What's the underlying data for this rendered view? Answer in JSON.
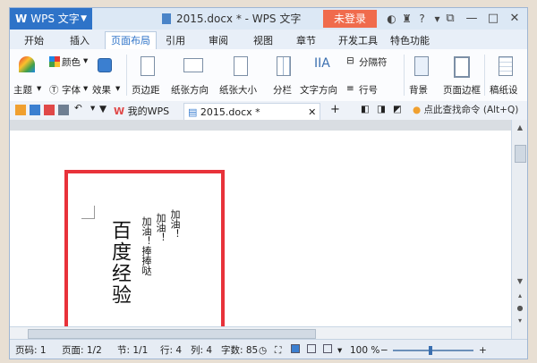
{
  "app": {
    "name": "WPS 文字",
    "logo": "W"
  },
  "document": {
    "title": "2015.docx * - WPS 文字"
  },
  "titlebar": {
    "login_label": "未登录"
  },
  "menu_tabs": [
    "开始",
    "插入",
    "页面布局",
    "引用",
    "审阅",
    "视图",
    "章节",
    "开发工具",
    "特色功能"
  ],
  "ribbon": {
    "theme": "主题",
    "color": "颜色",
    "font": "字体",
    "effect": "效果",
    "margins": "页边距",
    "orientation": "纸张方向",
    "paper_size": "纸张大小",
    "columns": "分栏",
    "text_direction": "文字方向",
    "break": "分隔符",
    "line_numbers": "行号",
    "background": "背景",
    "page_border": "页面边框",
    "manuscript": "稿纸设"
  },
  "doc_tabs": {
    "home": "我的WPS",
    "current": "2015.docx *"
  },
  "command_search": "点此查找命令 (Alt+Q)",
  "content": {
    "big_column": "百度经验",
    "col2": "加油！捧捧哒",
    "col3": "加油！",
    "col4": "加油！"
  },
  "status": {
    "page_code": "页码: 1",
    "pages": "页面: 1/2",
    "section": "节: 1/1",
    "row": "行: 4",
    "col": "列: 4",
    "words": "字数: 85",
    "zoom": "100 %"
  },
  "colors": {
    "accent": "#2e73c8",
    "login": "#f06b4c",
    "highlight_box": "#e8323a"
  }
}
